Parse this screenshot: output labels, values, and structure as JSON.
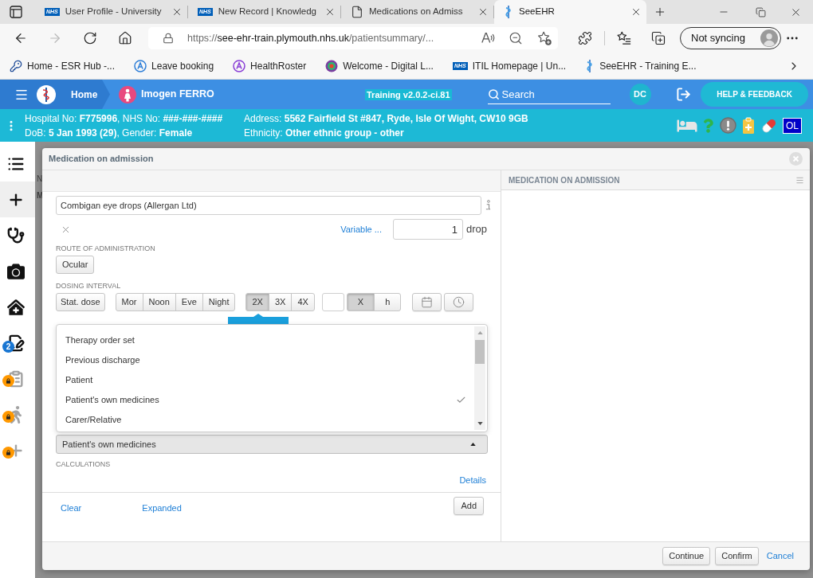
{
  "browser": {
    "tabs": [
      {
        "kind": "nhs",
        "favicon_text": "NHS",
        "title": "User Profile - University",
        "selected": false
      },
      {
        "kind": "nhs",
        "favicon_text": "NHS",
        "title": "New Record | Knowledg",
        "selected": false
      },
      {
        "kind": "document",
        "title": "Medications on Admiss",
        "selected": false
      },
      {
        "kind": "app",
        "title": "SeeEHR",
        "selected": true
      }
    ],
    "back": {
      "disabled": false
    },
    "forward": {
      "disabled": true
    },
    "url": {
      "scheme": "https://",
      "host": "see-ehr-train.plymouth.nhs.uk",
      "path": "/patientsummary/..."
    },
    "profile_label": "Not syncing",
    "bookmarks": [
      {
        "kind": "key",
        "label": "Home - ESR Hub -..."
      },
      {
        "kind": "ring_logo",
        "color": "#2f7fd8",
        "label": "Leave booking"
      },
      {
        "kind": "ring_logo",
        "color": "#8a3fd6",
        "label": "HealthRoster"
      },
      {
        "kind": "multicolor",
        "label": "Welcome - Digital L..."
      },
      {
        "kind": "nhs",
        "favicon_text": "NHS",
        "label": "ITIL Homepage | Un..."
      },
      {
        "kind": "app",
        "label": "SeeEHR - Training E..."
      }
    ]
  },
  "app_header": {
    "home": "Home",
    "patient_name": "Imogen FERRO",
    "version": "Training v2.0.2-ci.81",
    "search": {
      "placeholder": "Search"
    },
    "user_initials": "DC",
    "help_label": "HELP & FEEDBACK"
  },
  "patient_banner": {
    "identifiers": "Hospital No: **F775996**, NHS No: **###-###-####**",
    "address": "Address: **5562 Fairfield St #847, Ryde, Isle Of Wight, CW10 9GB**",
    "demographics": "DoB: **5 Jan 1993 (29)**, Gender: **Female**",
    "ethnicity": "Ethnicity: **Other ethnic group - other**",
    "badge": "OL"
  },
  "sidebar": {
    "items": [
      {
        "selected": false,
        "locked": false
      },
      {
        "selected": true,
        "locked": false
      },
      {
        "selected": false,
        "locked": false
      },
      {
        "selected": false,
        "locked": false
      },
      {
        "selected": false,
        "locked": false
      },
      {
        "selected": false,
        "locked": false,
        "badge": "2"
      },
      {
        "selected": false,
        "locked": true
      },
      {
        "selected": false,
        "locked": true
      },
      {
        "selected": false,
        "locked": true
      }
    ]
  },
  "background_texts": [
    "N",
    "M"
  ],
  "dialog": {
    "title": "Medication on admission",
    "form": {
      "medication": {
        "value": "Combigan eye drops (Allergan Ltd)"
      },
      "variable_link": "Variable ...",
      "dose": {
        "value": "1",
        "unit": "drop"
      },
      "route": {
        "label": "ROUTE OF ADMINISTRATION",
        "options": [
          {
            "label": "Ocular",
            "selected": false
          }
        ]
      },
      "dosing_interval": {
        "label": "DOSING INTERVAL",
        "stat_dose": {
          "label": "Stat. dose",
          "selected": false
        },
        "times": [
          {
            "label": "Mor",
            "selected": false
          },
          {
            "label": "Noon",
            "selected": false
          },
          {
            "label": "Eve",
            "selected": false
          },
          {
            "label": "Night",
            "selected": false
          }
        ],
        "frequencies": [
          {
            "label": "2X",
            "selected": true
          },
          {
            "label": "3X",
            "selected": false
          },
          {
            "label": "4X",
            "selected": false
          }
        ],
        "units": [
          {
            "label": "X",
            "selected": true
          },
          {
            "label": "h",
            "selected": false
          }
        ]
      },
      "source": {
        "value": "Patient's own medicines",
        "expanded": true,
        "options": [
          {
            "label": "Therapy order set",
            "selected": false
          },
          {
            "label": "Previous discharge",
            "selected": false
          },
          {
            "label": "Patient",
            "selected": false
          },
          {
            "label": "Patient's own medicines",
            "selected": true
          },
          {
            "label": "Carer/Relative",
            "selected": false
          }
        ]
      },
      "calculations_label": "CALCULATIONS",
      "details_link": "Details",
      "actions": {
        "clear": "Clear",
        "expanded": "Expanded",
        "add": "Add"
      }
    },
    "summary_panel": {
      "title": "MEDICATION ON ADMISSION"
    },
    "footer": {
      "buttons": [
        {
          "kind": "button",
          "label": "Continue"
        },
        {
          "kind": "button",
          "label": "Confirm"
        },
        {
          "kind": "link",
          "label": "Cancel"
        }
      ]
    }
  }
}
